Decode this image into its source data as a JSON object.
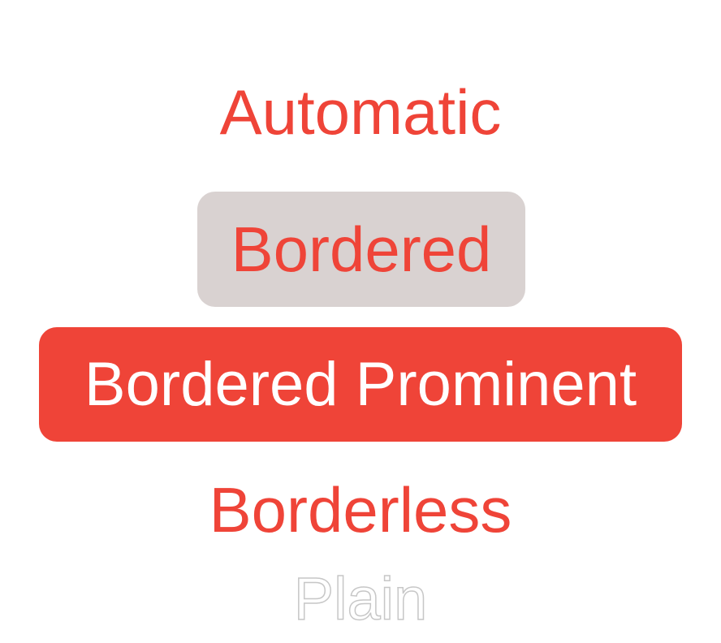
{
  "buttons": {
    "automatic": "Automatic",
    "bordered": "Bordered",
    "bordered_prominent": "Bordered Prominent",
    "borderless": "Borderless",
    "plain": "Plain"
  },
  "colors": {
    "accent": "#ef4438",
    "bordered_background": "#d9d2d1",
    "prominent_text": "#ffffff",
    "plain_outline": "#c7c7c7"
  }
}
